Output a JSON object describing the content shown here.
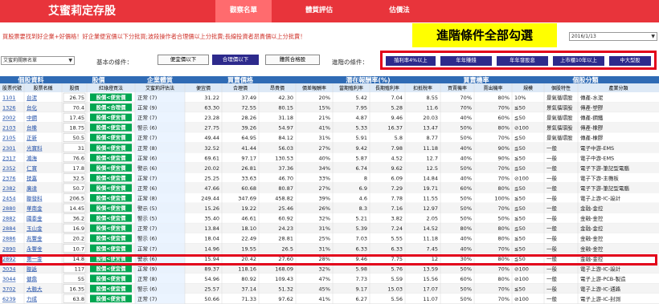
{
  "app": {
    "title": "艾蜜莉定存股",
    "nav": [
      "觀察名單",
      "體質評估",
      "估價法"
    ]
  },
  "tagline": "買股票要找到好企業+好價格！好企業便宜價以下分批買;波段操作者合理價以上分批賣;長線投資者昂貴價以上分批賣！",
  "callout": "進階條件全部勾選",
  "date_select": "2016/1/13",
  "list_select": "艾蜜莉關察名單",
  "basic": {
    "label": "基本の條件：",
    "buttons": [
      "便宜價以下",
      "合理價以下",
      "體質合格股"
    ]
  },
  "advanced": {
    "label": "進階の條件：",
    "buttons": [
      "殖利率4%以上",
      "年年賺錢",
      "年年發股息",
      "上市櫃10年以上",
      "中大型股"
    ]
  },
  "columns": {
    "groups": [
      "個股資料",
      "股價",
      "企業體質",
      "買賣價格",
      "潛在報酬率(%)",
      "買賣機率",
      "個股分類"
    ],
    "sub": [
      "股票代號",
      "股票名稱",
      "股價",
      "紅綠燈買法",
      "艾蜜莉評估法",
      "便宜價",
      "合理價",
      "昂貴價",
      "價差報酬率",
      "當期殖利率",
      "長期殖利率",
      "扣抵稅率",
      "買賣機率",
      "賣出機率",
      "規模",
      "個股特性",
      "產業分類"
    ]
  },
  "rows": [
    {
      "code": "1101",
      "name": "台泥",
      "price": "26.75",
      "signal": "股價<便宜價",
      "eval": "正常 (7)",
      "cheap": "31.22",
      "fair": "37.49",
      "exp": "42.30",
      "spread": "20%",
      "cur": "5.42",
      "long": "7.04",
      "tax": "8.55",
      "buy": "70%",
      "sell": "80%",
      "scale": "10%",
      "trait": "景氣循環股",
      "ind": "傳產-水泥"
    },
    {
      "code": "1326",
      "name": "台化",
      "price": "70.4",
      "signal": "股價<合理價",
      "eval": "正常 (9)",
      "cheap": "63.30",
      "fair": "72.55",
      "exp": "80.15",
      "spread": "15%",
      "cur": "7.95",
      "long": "5.28",
      "tax": "11.6",
      "buy": "70%",
      "sell": "70%",
      "scale": "≦50",
      "trait": "景氣循環股",
      "ind": "傳產-塑膠"
    },
    {
      "code": "2002",
      "name": "中鋼",
      "price": "17.45",
      "signal": "股價<便宜價",
      "eval": "正常 (7)",
      "cheap": "23.28",
      "fair": "28.26",
      "exp": "31.18",
      "spread": "21%",
      "cur": "4.87",
      "long": "9.46",
      "tax": "20.03",
      "buy": "40%",
      "sell": "60%",
      "scale": "≦50",
      "trait": "景氣循環股",
      "ind": "傳產-鋼鐵"
    },
    {
      "code": "2103",
      "name": "台橡",
      "price": "18.75",
      "signal": "股價<便宜價",
      "eval": "警示 (6)",
      "cheap": "27.75",
      "fair": "39.26",
      "exp": "54.97",
      "spread": "41%",
      "cur": "5.33",
      "long": "16.37",
      "tax": "13.47",
      "buy": "50%",
      "sell": "80%",
      "scale": "⊘100",
      "trait": "景氣循環股",
      "ind": "傳產-橡膠"
    },
    {
      "code": "2105",
      "name": "正新",
      "price": "50.5",
      "signal": "股價<便宜價",
      "eval": "正常 (7)",
      "cheap": "49.44",
      "fair": "64.95",
      "exp": "84.12",
      "spread": "31%",
      "cur": "5.91",
      "long": "5.8",
      "tax": "8.77",
      "buy": "50%",
      "sell": "70%",
      "scale": "≦50",
      "trait": "景氣循環股",
      "ind": "傳產-橡膠"
    },
    {
      "code": "2301",
      "name": "光寶科",
      "price": "31",
      "signal": "股價<便宜價",
      "eval": "正常 (8)",
      "cheap": "32.52",
      "fair": "41.44",
      "exp": "56.03",
      "spread": "27%",
      "cur": "9.42",
      "long": "7.98",
      "tax": "11.18",
      "buy": "40%",
      "sell": "90%",
      "scale": "≦50",
      "trait": "一般",
      "ind": "電子中游-EMS"
    },
    {
      "code": "2317",
      "name": "鴻海",
      "price": "76.6",
      "signal": "股價<便宜價",
      "eval": "正常 (6)",
      "cheap": "69.61",
      "fair": "97.17",
      "exp": "130.53",
      "spread": "40%",
      "cur": "5.87",
      "long": "4.52",
      "tax": "12.7",
      "buy": "40%",
      "sell": "90%",
      "scale": "≦50",
      "trait": "一般",
      "ind": "電子中游-EMS"
    },
    {
      "code": "2352",
      "name": "仁寶",
      "price": "17.8",
      "signal": "股價<便宜價",
      "eval": "警示 (6)",
      "cheap": "20.02",
      "fair": "26.81",
      "exp": "37.36",
      "spread": "34%",
      "cur": "6.74",
      "long": "9.62",
      "tax": "12.5",
      "buy": "50%",
      "sell": "70%",
      "scale": "≦50",
      "trait": "一般",
      "ind": "電子下游-筆記型電腦"
    },
    {
      "code": "2376",
      "name": "技嘉",
      "price": "32.5",
      "signal": "股價<便宜價",
      "eval": "正常 (7)",
      "cheap": "25.25",
      "fair": "33.63",
      "exp": "46.70",
      "spread": "33%",
      "cur": "8",
      "long": "6.09",
      "tax": "14.84",
      "buy": "40%",
      "sell": "70%",
      "scale": "⊘100",
      "trait": "一般",
      "ind": "電子下游-主機板"
    },
    {
      "code": "2382",
      "name": "廣達",
      "price": "50.7",
      "signal": "股價<便宜價",
      "eval": "正常 (6)",
      "cheap": "47.66",
      "fair": "60.68",
      "exp": "80.87",
      "spread": "27%",
      "cur": "6.9",
      "long": "7.29",
      "tax": "19.71",
      "buy": "60%",
      "sell": "80%",
      "scale": "≦50",
      "trait": "一般",
      "ind": "電子下游-筆記型電腦"
    },
    {
      "code": "2454",
      "name": "聯發科",
      "price": "206.5",
      "signal": "股價<便宜價",
      "eval": "正常 (8)",
      "cheap": "249.44",
      "fair": "347.69",
      "exp": "458.82",
      "spread": "39%",
      "cur": "4.6",
      "long": "7.78",
      "tax": "11.55",
      "buy": "50%",
      "sell": "100%",
      "scale": "≦50",
      "trait": "一般",
      "ind": "電子上游-IC-設計"
    },
    {
      "code": "2880",
      "name": "華南金",
      "price": "14.45",
      "signal": "股價<便宜價",
      "eval": "警示 (5)",
      "cheap": "15.26",
      "fair": "19.22",
      "exp": "25.46",
      "spread": "26%",
      "cur": "8.3",
      "long": "7.16",
      "tax": "12.97",
      "buy": "50%",
      "sell": "70%",
      "scale": "≦50",
      "trait": "一般",
      "ind": "金融-金控"
    },
    {
      "code": "2882",
      "name": "國泰金",
      "price": "36.2",
      "signal": "股價<便宜價",
      "eval": "警示 (5)",
      "cheap": "35.40",
      "fair": "46.61",
      "exp": "60.92",
      "spread": "32%",
      "cur": "5.21",
      "long": "3.82",
      "tax": "2.05",
      "buy": "50%",
      "sell": "50%",
      "scale": "≦50",
      "trait": "一般",
      "ind": "金融-金控"
    },
    {
      "code": "2884",
      "name": "玉山金",
      "price": "16.9",
      "signal": "股價<便宜價",
      "eval": "正常 (7)",
      "cheap": "13.84",
      "fair": "18.10",
      "exp": "24.23",
      "spread": "31%",
      "cur": "5.39",
      "long": "7.24",
      "tax": "14.52",
      "buy": "80%",
      "sell": "80%",
      "scale": "≦50",
      "trait": "一般",
      "ind": "金融-金控"
    },
    {
      "code": "2886",
      "name": "兆豐金",
      "price": "20.2",
      "signal": "股價<便宜價",
      "eval": "警示 (6)",
      "cheap": "18.04",
      "fair": "22.49",
      "exp": "28.81",
      "spread": "25%",
      "cur": "7.03",
      "long": "5.55",
      "tax": "11.18",
      "buy": "40%",
      "sell": "80%",
      "scale": "≦50",
      "trait": "一般",
      "ind": "金融-金控"
    },
    {
      "code": "2890",
      "name": "永豐金",
      "price": "10.7",
      "signal": "股價<便宜價",
      "eval": "正常 (7)",
      "cheap": "14.96",
      "fair": "19.55",
      "exp": "26.5",
      "spread": "31%",
      "cur": "6.33",
      "long": "6.33",
      "tax": "7.45",
      "buy": "40%",
      "sell": "70%",
      "scale": "≦50",
      "trait": "一般",
      "ind": "金融-金控"
    },
    {
      "code": "2892",
      "name": "第一金",
      "price": "14.8",
      "signal": "股價<便宜價",
      "eval": "警示 (6)",
      "cheap": "15.94",
      "fair": "20.42",
      "exp": "27.60",
      "spread": "28%",
      "cur": "9.46",
      "long": "7.75",
      "tax": "12",
      "buy": "30%",
      "sell": "80%",
      "scale": "≦50",
      "trait": "一般",
      "ind": "金融-金控"
    },
    {
      "code": "3034",
      "name": "聯詠",
      "price": "117",
      "signal": "股價<便宜價",
      "eval": "正常 (9)",
      "cheap": "89.37",
      "fair": "118.16",
      "exp": "168.09",
      "spread": "32%",
      "cur": "5.98",
      "long": "5.76",
      "tax": "13.59",
      "buy": "50%",
      "sell": "70%",
      "scale": "⊘100",
      "trait": "一般",
      "ind": "電子上游-IC-設計"
    },
    {
      "code": "3044",
      "name": "健鼎",
      "price": "55",
      "signal": "股價<便宜價",
      "eval": "正常 (8)",
      "cheap": "54.96",
      "fair": "80.92",
      "exp": "109.43",
      "spread": "47%",
      "cur": "7.73",
      "long": "5.59",
      "tax": "15.56",
      "buy": "60%",
      "sell": "80%",
      "scale": "⊘100",
      "trait": "一般",
      "ind": "電子上游-PCB-製造"
    },
    {
      "code": "3702",
      "name": "大聯大",
      "price": "16.35",
      "signal": "股價<便宜價",
      "eval": "警示 (6)",
      "cheap": "25.57",
      "fair": "37.14",
      "exp": "51.32",
      "spread": "45%",
      "cur": "9.17",
      "long": "15.03",
      "tax": "17.07",
      "buy": "50%",
      "sell": "70%",
      "scale": "≦50",
      "trait": "一般",
      "ind": "電子上游-IC-通路"
    },
    {
      "code": "6239",
      "name": "力成",
      "price": "63.8",
      "signal": "股價<便宜價",
      "eval": "正常 (7)",
      "cheap": "50.66",
      "fair": "71.33",
      "exp": "97.62",
      "spread": "41%",
      "cur": "6.27",
      "long": "5.56",
      "tax": "11.07",
      "buy": "50%",
      "sell": "70%",
      "scale": "⊘100",
      "trait": "一般",
      "ind": "電子上游-IC-封測"
    }
  ],
  "colors": {
    "header": "#e8343b",
    "signal_green": "#00a651",
    "button_blue": "#2d2a8c",
    "group_header": "#2f6bb5",
    "highlight": "#e2001a"
  }
}
